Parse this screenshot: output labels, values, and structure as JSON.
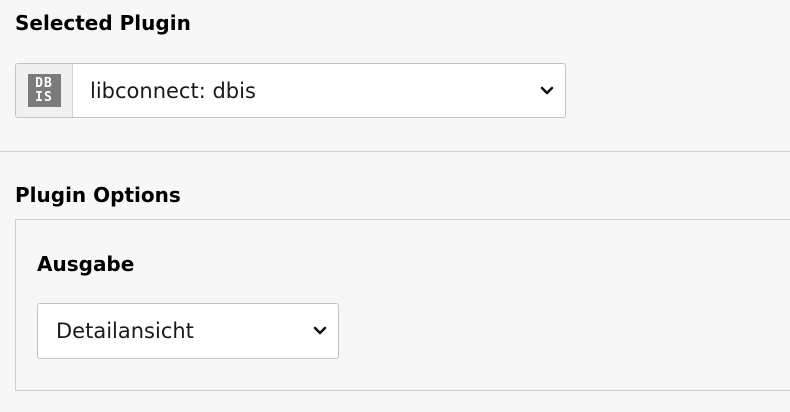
{
  "selected_plugin": {
    "title": "Selected Plugin",
    "icon": {
      "name": "dbis-plugin-icon",
      "line1": "DB",
      "line2": "IS",
      "bg_color": "#7b7b7b"
    },
    "value": "libconnect: dbis"
  },
  "plugin_options": {
    "title": "Plugin Options",
    "output_field": {
      "label": "Ausgabe",
      "value": "Detailansicht"
    }
  }
}
